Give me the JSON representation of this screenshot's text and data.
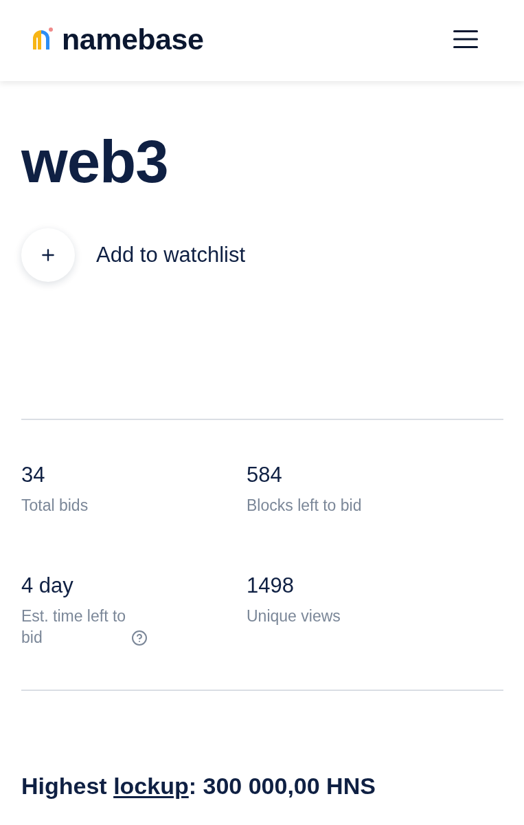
{
  "header": {
    "logo_text": "namebase"
  },
  "domain": {
    "name": "web3"
  },
  "watchlist": {
    "label": "Add to watchlist"
  },
  "stats": [
    {
      "value": "34",
      "label": "Total bids",
      "help": false
    },
    {
      "value": "584",
      "label": "Blocks left to bid",
      "help": false
    },
    {
      "value": "4 day",
      "label": "Est. time left to bid",
      "help": true
    },
    {
      "value": "1498",
      "label": "Unique views",
      "help": false
    }
  ],
  "lockup": {
    "prefix": "Highest",
    "link": "lockup",
    "suffix": ": 300 000,00 HNS"
  }
}
